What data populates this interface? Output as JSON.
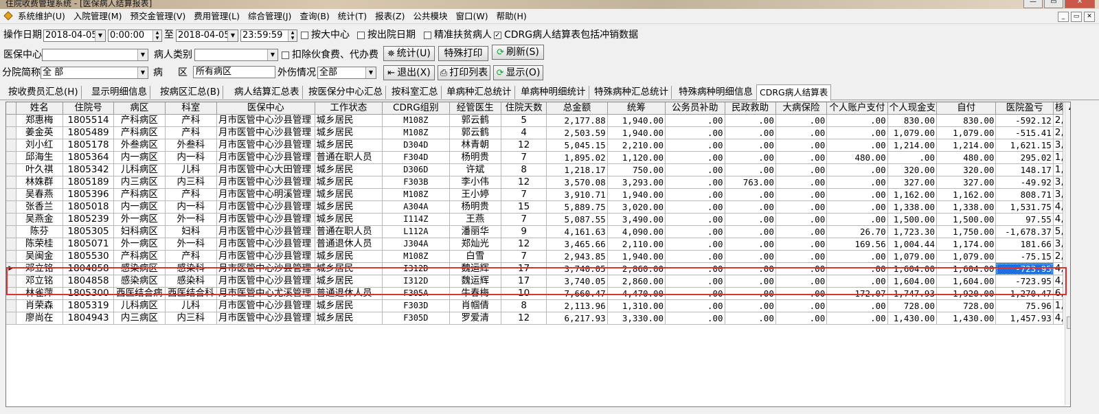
{
  "window": {
    "title": "住院收费管理系统 - [医保病人结算报表]",
    "min": "—",
    "max": "▭",
    "close": "✕"
  },
  "menu": [
    "系统维护(U)",
    "入院管理(M)",
    "预交金管理(V)",
    "费用管理(L)",
    "综合管理(J)",
    "查询(B)",
    "统计(T)",
    "报表(Z)",
    "公共模块",
    "窗口(W)",
    "帮助(H)"
  ],
  "mdi": [
    "_",
    "▭",
    "✕"
  ],
  "filters": {
    "op_date_label": "操作日期",
    "date_from": "2018-04-05",
    "time_from": "0:00:00",
    "to_label": "至",
    "date_to": "2018-04-05",
    "time_to": "23:59:59",
    "chk_center": "按大中心",
    "chk_discharge": "按出院日期",
    "chk_poverty": "精准扶贫病人",
    "chk_cdrg": "CDRG病人结算表包括冲销数据",
    "insurance_center_label": "医保中心",
    "insurance_center_value": "",
    "patient_type_label": "病人类别",
    "patient_type_value": "",
    "chk_deduct": "扣除伙食费、代办费",
    "branch_label": "分院简称",
    "branch_value": "全 部",
    "ward_label1": "病",
    "ward_label2": "区",
    "ward_value": "所有病区",
    "injury_label": "外伤情况",
    "injury_value": "全部"
  },
  "buttons": {
    "stats": "统计(U)",
    "special_print": "特殊打印",
    "refresh": "刷新(S)",
    "exit": "退出(X)",
    "print_list": "打印列表",
    "show": "显示(O)"
  },
  "tabs": [
    "按收费员汇总(H)",
    "显示明细信息",
    "按病区汇总(B)",
    "病人结算汇总表",
    "按医保分中心汇总",
    "按科室汇总",
    "单病种汇总统计",
    "单病种明细统计",
    "特殊病种汇总统计",
    "特殊病种明细信息",
    "CDRG病人结算表"
  ],
  "grid": {
    "columns": [
      "姓名",
      "住院号",
      "病区",
      "科室",
      "医保中心",
      "工作状态",
      "CDRG组别",
      "经管医生",
      "住院天数",
      "总金额",
      "统筹",
      "公务员补助",
      "民政救助",
      "大病保险",
      "个人账户支付",
      "个人现金支",
      "自付",
      "医院盈亏",
      "核"
    ],
    "rows": [
      [
        "郑惠梅",
        "1805514",
        "产科病区",
        "产科",
        "月市医管中心沙县管理",
        "城乡居民",
        "M108Z",
        "郭云鹤",
        "5",
        "2,177.88",
        "1,940.00",
        ".00",
        ".00",
        ".00",
        ".00",
        "830.00",
        "830.00",
        "-592.12",
        "2,"
      ],
      [
        "姜金英",
        "1805489",
        "产科病区",
        "产科",
        "月市医管中心沙县管理",
        "城乡居民",
        "M108Z",
        "郭云鹤",
        "4",
        "2,503.59",
        "1,940.00",
        ".00",
        ".00",
        ".00",
        ".00",
        "1,079.00",
        "1,079.00",
        "-515.41",
        "2,"
      ],
      [
        "刘小红",
        "1805178",
        "外叁病区",
        "外叁科",
        "月市医管中心沙县管理",
        "城乡居民",
        "D304D",
        "林青朝",
        "12",
        "5,045.15",
        "2,210.00",
        ".00",
        ".00",
        ".00",
        ".00",
        "1,214.00",
        "1,214.00",
        "1,621.15",
        "3,"
      ],
      [
        "邱海生",
        "1805364",
        "内一病区",
        "内一科",
        "月市医管中心沙县管理",
        "普通在职人员",
        "F304D",
        "杨明贵",
        "7",
        "1,895.02",
        "1,120.00",
        ".00",
        ".00",
        ".00",
        "480.00",
        ".00",
        "480.00",
        "295.02",
        "1,"
      ],
      [
        "叶久祺",
        "1805342",
        "儿科病区",
        "儿科",
        "月市医管中心大田管理",
        "城乡居民",
        "D306D",
        "许斌",
        "8",
        "1,218.17",
        "750.00",
        ".00",
        ".00",
        ".00",
        ".00",
        "320.00",
        "320.00",
        "148.17",
        "1,"
      ],
      [
        "林姝群",
        "1805189",
        "内三病区",
        "内三科",
        "月市医管中心沙县管理",
        "城乡居民",
        "F303B",
        "李小伟",
        "12",
        "3,570.08",
        "3,293.00",
        ".00",
        "763.00",
        ".00",
        ".00",
        "327.00",
        "327.00",
        "-49.92",
        "3,"
      ],
      [
        "吴春燕",
        "1805396",
        "产科病区",
        "产科",
        "月市医管中心明溪管理",
        "城乡居民",
        "M108Z",
        "王小婷",
        "7",
        "3,910.71",
        "1,940.00",
        ".00",
        ".00",
        ".00",
        ".00",
        "1,162.00",
        "1,162.00",
        "808.71",
        "3,"
      ],
      [
        "张香兰",
        "1805018",
        "内一病区",
        "内一科",
        "月市医管中心沙县管理",
        "城乡居民",
        "A304A",
        "杨明贵",
        "15",
        "5,889.75",
        "3,020.00",
        ".00",
        ".00",
        ".00",
        ".00",
        "1,338.00",
        "1,338.00",
        "1,531.75",
        "4,"
      ],
      [
        "吴燕金",
        "1805239",
        "外一病区",
        "外一科",
        "月市医管中心沙县管理",
        "城乡居民",
        "I114Z",
        "王燕",
        "7",
        "5,087.55",
        "3,490.00",
        ".00",
        ".00",
        ".00",
        ".00",
        "1,500.00",
        "1,500.00",
        "97.55",
        "4,"
      ],
      [
        "陈芬",
        "1805305",
        "妇科病区",
        "妇科",
        "月市医管中心沙县管理",
        "普通在职人员",
        "L112A",
        "潘丽华",
        "9",
        "4,161.63",
        "4,090.00",
        ".00",
        ".00",
        ".00",
        "26.70",
        "1,723.30",
        "1,750.00",
        "-1,678.37",
        "5,"
      ],
      [
        "陈荣桂",
        "1805071",
        "外一病区",
        "外一科",
        "月市医管中心沙县管理",
        "普通退休人员",
        "J304A",
        "郑灿光",
        "12",
        "3,465.66",
        "2,110.00",
        ".00",
        ".00",
        ".00",
        "169.56",
        "1,004.44",
        "1,174.00",
        "181.66",
        "3,"
      ],
      [
        "吴闽金",
        "1805530",
        "产科病区",
        "产科",
        "月市医管中心沙县管理",
        "城乡居民",
        "M108Z",
        "白雪",
        "7",
        "2,943.85",
        "1,940.00",
        ".00",
        ".00",
        ".00",
        ".00",
        "1,079.00",
        "1,079.00",
        "-75.15",
        "2,"
      ],
      [
        "邓立铭",
        "1804858",
        "感染病区",
        "感染科",
        "月市医管中心沙县管理",
        "城乡居民",
        "I312D",
        "魏运辉",
        "17",
        "3,740.05",
        "2,860.00",
        ".00",
        ".00",
        ".00",
        ".00",
        "1,604.00",
        "1,604.00",
        "-723.95",
        "4,"
      ],
      [
        "邓立铭",
        "1804858",
        "感染病区",
        "感染科",
        "月市医管中心沙县管理",
        "城乡居民",
        "I312D",
        "魏运辉",
        "17",
        "3,740.05",
        "2,860.00",
        ".00",
        ".00",
        ".00",
        ".00",
        "1,604.00",
        "1,604.00",
        "-723.95",
        "4,"
      ],
      [
        "林雀萍",
        "1805300",
        "西医结合病",
        "西医结合科",
        "月市医管中心尤溪管理",
        "普通退休人员",
        "F305A",
        "牛春梅",
        "10",
        "7,660.47",
        "4,470.00",
        ".00",
        ".00",
        ".00",
        "172.07",
        "1,747.93",
        "1,920.00",
        "1,270.47",
        "6,"
      ],
      [
        "肖荣森",
        "1805319",
        "儿科病区",
        "儿科",
        "月市医管中心沙县管理",
        "城乡居民",
        "F303D",
        "肖帼倩",
        "8",
        "2,113.96",
        "1,310.00",
        ".00",
        ".00",
        ".00",
        ".00",
        "728.00",
        "728.00",
        "75.96",
        "1,"
      ],
      [
        "廖尚在",
        "1804943",
        "内三病区",
        "内三科",
        "月市医管中心沙县管理",
        "城乡居民",
        "F305D",
        "罗爱清",
        "12",
        "6,217.93",
        "3,330.00",
        ".00",
        ".00",
        ".00",
        ".00",
        "1,430.00",
        "1,430.00",
        "1,457.93",
        "4,"
      ]
    ]
  },
  "colors": {
    "selection": "#1e6fe0",
    "highlight_box": "#e03030"
  }
}
